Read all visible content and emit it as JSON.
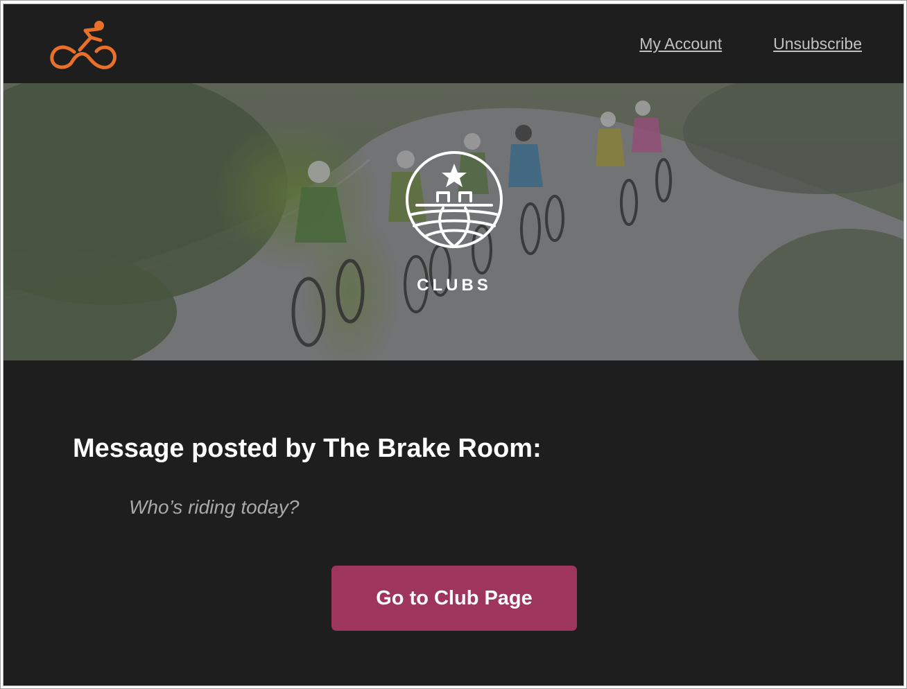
{
  "header": {
    "logo_icon": "cyclist-logo-icon",
    "nav": {
      "my_account": "My Account",
      "unsubscribe": "Unsubscribe"
    }
  },
  "hero": {
    "image": "group-of-cyclists-riding-on-road",
    "emblem_icon": "clubs-emblem-icon",
    "label": "CLUBS"
  },
  "message": {
    "title": "Message posted by The Brake Room:",
    "body": "Who’s riding today?"
  },
  "cta": {
    "label": "Go to Club Page"
  },
  "colors": {
    "background": "#1e1e1e",
    "brand_orange": "#e8702a",
    "cta_background": "#9e355c",
    "link": "#c2c2c2",
    "body_text": "#a9a9a9"
  }
}
